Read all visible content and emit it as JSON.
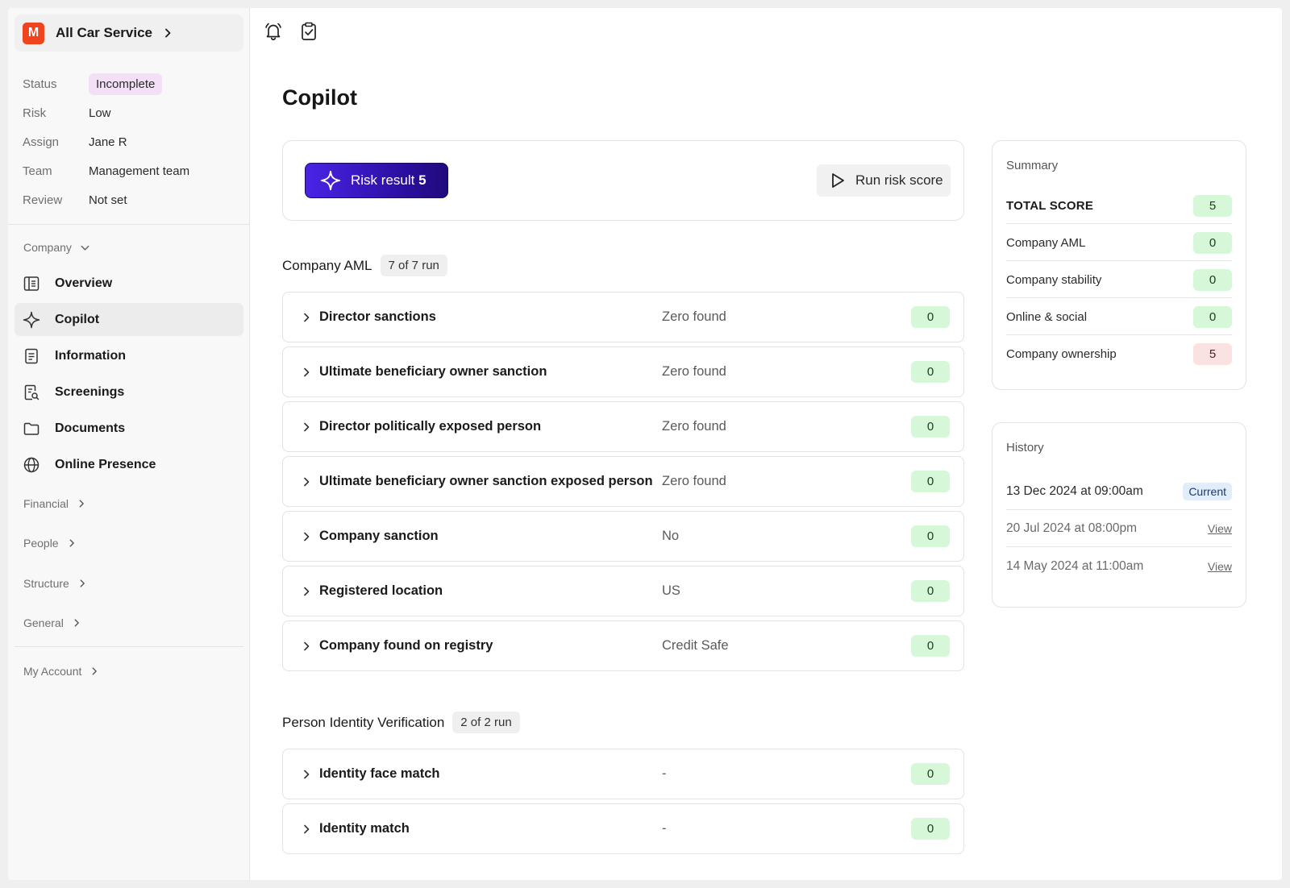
{
  "org": {
    "initial": "M",
    "name": "All Car Service"
  },
  "meta": [
    {
      "key": "Status",
      "value": "Incomplete"
    },
    {
      "key": "Risk",
      "value": "Low"
    },
    {
      "key": "Assign",
      "value": "Jane R"
    },
    {
      "key": "Team",
      "value": "Management team"
    },
    {
      "key": "Review",
      "value": "Not set"
    }
  ],
  "nav": {
    "company_label": "Company",
    "items": [
      "Overview",
      "Copilot",
      "Information",
      "Screenings",
      "Documents",
      "Online Presence"
    ],
    "groups": [
      "Financial",
      "People",
      "Structure",
      "General"
    ],
    "account": "My Account"
  },
  "page": {
    "title": "Copilot"
  },
  "actions": {
    "risk_label": "Risk result",
    "risk_value": "5",
    "run_label": "Run risk score"
  },
  "sections": [
    {
      "title": "Company AML",
      "count": "7 of 7 run",
      "rows": [
        {
          "name": "Director sanctions",
          "result": "Zero found",
          "score": "0"
        },
        {
          "name": "Ultimate beneficiary owner sanction",
          "result": "Zero found",
          "score": "0"
        },
        {
          "name": "Director politically exposed person",
          "result": "Zero found",
          "score": "0"
        },
        {
          "name": "Ultimate beneficiary owner sanction exposed person",
          "result": "Zero found",
          "score": "0"
        },
        {
          "name": "Company sanction",
          "result": "No",
          "score": "0"
        },
        {
          "name": "Registered location",
          "result": "US",
          "score": "0"
        },
        {
          "name": "Company found on registry",
          "result": "Credit Safe",
          "score": "0"
        }
      ]
    },
    {
      "title": "Person Identity Verification",
      "count": "2 of 2 run",
      "rows": [
        {
          "name": "Identity face match",
          "result": "-",
          "score": "0"
        },
        {
          "name": "Identity match",
          "result": "-",
          "score": "0"
        }
      ]
    }
  ],
  "summary": {
    "title": "Summary",
    "rows": [
      {
        "label": "TOTAL SCORE",
        "value": "5"
      },
      {
        "label": "Company AML",
        "value": "0"
      },
      {
        "label": "Company stability",
        "value": "0"
      },
      {
        "label": "Online & social",
        "value": "0"
      },
      {
        "label": "Company ownership",
        "value": "5"
      }
    ]
  },
  "history": {
    "title": "History",
    "rows": [
      {
        "date": "13 Dec 2024 at 09:00am",
        "action": "Current"
      },
      {
        "date": "20 Jul 2024 at 08:00pm",
        "action": "View"
      },
      {
        "date": "14 May 2024 at 11:00am",
        "action": "View"
      }
    ]
  },
  "colors": {
    "accent": "#3a1bd1",
    "success_bg": "#d7f7d9",
    "danger_bg": "#fbe2e2",
    "status_bg": "#f3e0f7"
  }
}
